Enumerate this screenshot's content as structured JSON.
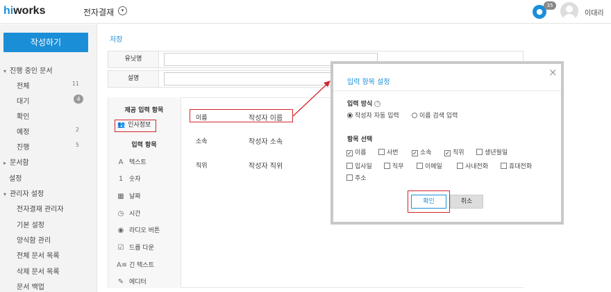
{
  "header": {
    "logo_hi": "hi",
    "logo_rest": "works",
    "app_title": "전자결재",
    "chevron_glyph": "▾",
    "bell_glyph": "🔔",
    "notification_count": "35",
    "user_name": "이대리"
  },
  "sidebar": {
    "compose_label": "작성하기",
    "items": [
      {
        "label": "진행 중인 문서",
        "type": "section"
      },
      {
        "label": "전체",
        "count": "11"
      },
      {
        "label": "대기",
        "count": "4"
      },
      {
        "label": "확인",
        "count": ""
      },
      {
        "label": "예정",
        "count": "2"
      },
      {
        "label": "진행",
        "count": "5"
      },
      {
        "label": "문서함",
        "type": "section-closed"
      },
      {
        "label": "설정",
        "type": "plain"
      },
      {
        "label": "관리자 설정",
        "type": "section"
      },
      {
        "label": "전자결재 관리자"
      },
      {
        "label": "기본 설정"
      },
      {
        "label": "양식함 관리"
      },
      {
        "label": "전체 문서 목록"
      },
      {
        "label": "삭제 문서 목록"
      },
      {
        "label": "문서 백업"
      }
    ]
  },
  "main": {
    "save_link": "저장",
    "form_rows": [
      {
        "label": "유닛명",
        "value": ""
      },
      {
        "label": "설명",
        "value": ""
      }
    ],
    "provided_items_title": "제공 입력 항목",
    "hr_info_label": "인사정보",
    "input_items_title": "입력 항목",
    "tools": [
      {
        "icon": "A",
        "label": "텍스트"
      },
      {
        "icon": "1",
        "label": "숫자"
      },
      {
        "icon": "▦",
        "label": "날짜"
      },
      {
        "icon": "◷",
        "label": "시간"
      },
      {
        "icon": "◉",
        "label": "라디오 버튼"
      },
      {
        "icon": "☑",
        "label": "드롭 다운"
      },
      {
        "icon": "A≡",
        "label": "긴 텍스트"
      },
      {
        "icon": "✎",
        "label": "에디터"
      }
    ],
    "properties": [
      {
        "label": "이름",
        "value": "작성자 이름"
      },
      {
        "label": "소속",
        "value": "작성자 소속"
      },
      {
        "label": "직위",
        "value": "작성자 직위"
      }
    ]
  },
  "modal": {
    "title": "입력 항목 설정",
    "close_glyph": "×",
    "input_method_label": "입력 방식",
    "help_glyph": "?",
    "input_methods": [
      {
        "label": "작성자 자동 입력",
        "selected": true
      },
      {
        "label": "이름 검색 입력",
        "selected": false
      }
    ],
    "item_select_label": "항목 선택",
    "fields": [
      {
        "label": "이름",
        "checked": true
      },
      {
        "label": "사번",
        "checked": false
      },
      {
        "label": "소속",
        "checked": true
      },
      {
        "label": "직위",
        "checked": true
      },
      {
        "label": "생년월일",
        "checked": false
      },
      {
        "label": "입사일",
        "checked": false
      },
      {
        "label": "직무",
        "checked": false
      },
      {
        "label": "이메일",
        "checked": false
      },
      {
        "label": "사내전화",
        "checked": false
      },
      {
        "label": "휴대전화",
        "checked": false
      },
      {
        "label": "주소",
        "checked": false
      }
    ],
    "ok_label": "확인",
    "cancel_label": "취소"
  },
  "colors": {
    "accent": "#1a8fd8",
    "highlight_red": "#d4242a",
    "sidebar_bg": "#f3f3f3"
  }
}
